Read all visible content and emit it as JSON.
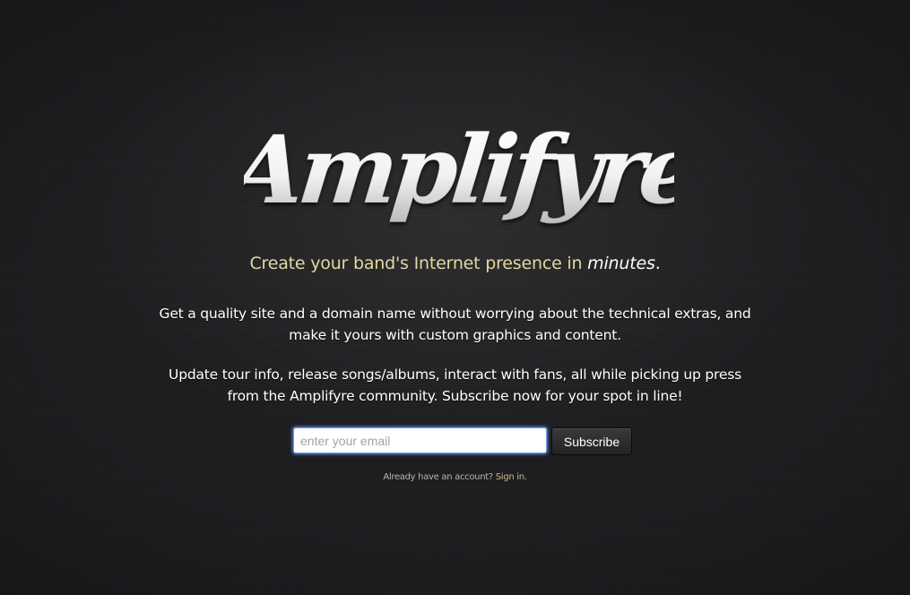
{
  "logo": {
    "text": "Amplifyre"
  },
  "tagline": {
    "before": "Create your band's Internet presence in ",
    "emphasis": "minutes",
    "after": ".",
    "color": "#e3d8a0"
  },
  "intro": {
    "paragraph_1_line_1": "Get a quality site and a domain name without worrying about the technical extras, and",
    "paragraph_1_line_2": "make it yours with custom graphics and content.",
    "paragraph_2_line_1": "Update tour info, release songs/albums, interact with fans, all while picking up press",
    "paragraph_2_line_2": "from the Amplifyre community. Subscribe now for your spot in line!"
  },
  "signup": {
    "email_placeholder": "enter your email",
    "email_value": "",
    "subscribe_label": "Subscribe"
  },
  "signin": {
    "prompt": "Already have an account? ",
    "link_label": "Sign in",
    "suffix": "."
  },
  "colors": {
    "background": "#1d1d20",
    "accent": "#e3d8a0",
    "input_focus": "#6f9be6"
  }
}
